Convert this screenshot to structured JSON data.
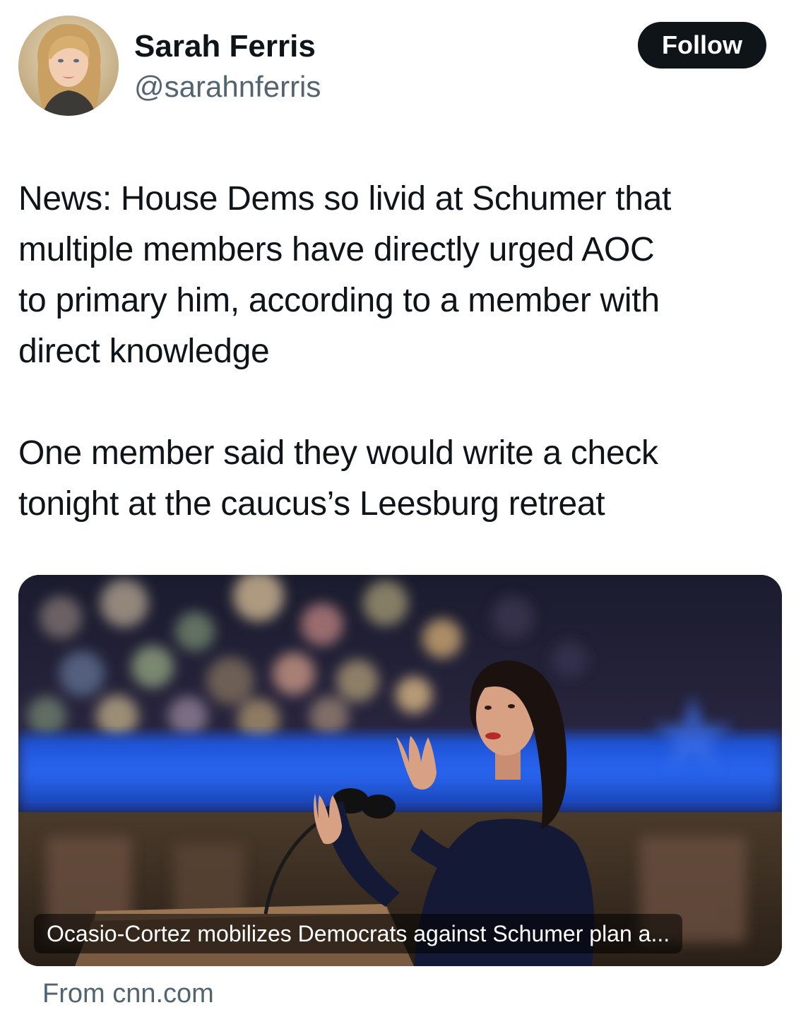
{
  "author": {
    "name": "Sarah Ferris",
    "handle": "@sarahnferris",
    "avatar_icon": "profile-photo"
  },
  "follow_button": {
    "label": "Follow"
  },
  "tweet": {
    "paragraphs": [
      [
        "News: House Dems so livid at Schumer that",
        "multiple members have directly urged AOC",
        "to primary him, according to a member with",
        "direct knowledge"
      ],
      [
        "One member said they would write a check",
        "tonight at the caucus’s Leesburg retreat"
      ]
    ]
  },
  "link_card": {
    "headline": "Ocasio-Cortez mobilizes Democrats against Schumer plan a...",
    "source": "From cnn.com",
    "image_icon": "speaker-at-podium-photo"
  },
  "colors": {
    "text_primary": "#0f1419",
    "text_secondary": "#536471",
    "button_bg": "#0f1419",
    "button_text": "#ffffff",
    "background": "#ffffff"
  }
}
